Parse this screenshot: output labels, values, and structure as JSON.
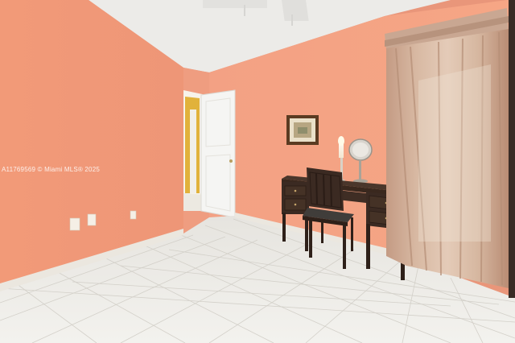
{
  "watermark": {
    "text": "A11769569 © Miami MLS® 2025"
  },
  "scene": {
    "description": "Empty bedroom with salmon walls, tiled floor, desk with chair, lamp, mirror, framed picture, curtained window and open white door",
    "colors": {
      "wall_left": "#F09A78",
      "wall_back": "#F4A283",
      "ceiling": "#ECECEA",
      "floor": "#EDEDE9",
      "baseboard": "#E8E4DC",
      "door": "#F4F4F2",
      "hall_wall": "#E2B43A",
      "curtain": "#C7A58E",
      "desk": "#3B2A22"
    }
  }
}
